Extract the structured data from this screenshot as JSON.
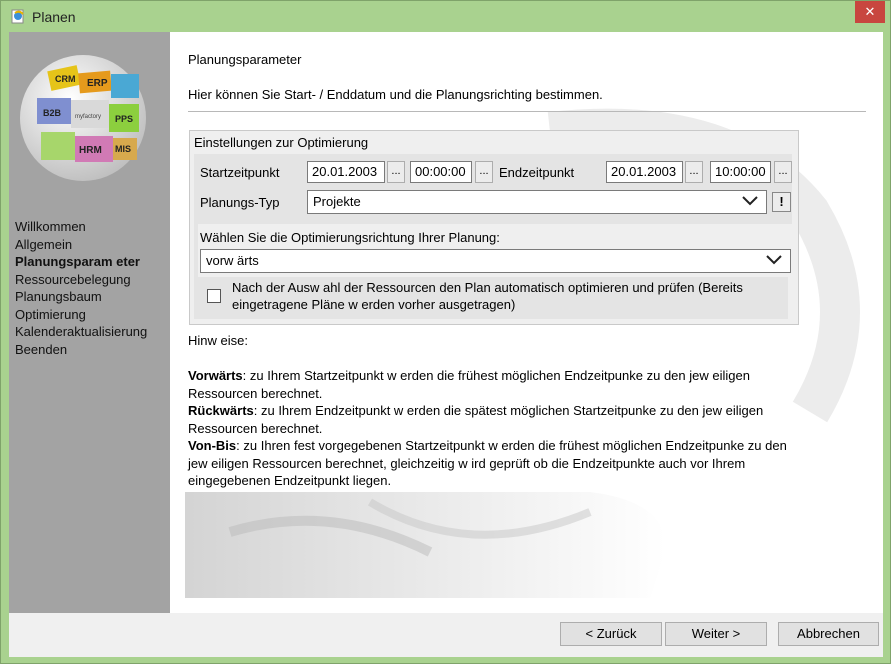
{
  "window": {
    "title": "Planen",
    "close_label": "✕"
  },
  "sidebar": {
    "items": [
      {
        "label": "Willkommen",
        "active": false
      },
      {
        "label": "Allgemein",
        "active": false
      },
      {
        "label": "Planungsparam eter",
        "active": true
      },
      {
        "label": "Ressourcebelegung",
        "active": false
      },
      {
        "label": "Planungsbaum",
        "active": false
      },
      {
        "label": "Optimierung",
        "active": false
      },
      {
        "label": "Kalenderaktualisierung",
        "active": false
      },
      {
        "label": "Beenden",
        "active": false
      }
    ],
    "logo_labels": [
      "CRM",
      "ERP",
      "B2B",
      "myfactory",
      "PPS",
      "HRM",
      "MIS"
    ]
  },
  "page": {
    "title": "Planungsparameter",
    "description": "Hier können Sie Start- / Enddatum und die Planungsrichting bestimmen."
  },
  "settings": {
    "group_title": "Einstellungen zur Optimierung",
    "start_label": "Startzeitpunkt",
    "start_date": "20.01.2003",
    "start_time": "00:00:00",
    "end_label": "Endzeitpunkt",
    "end_date": "20.01.2003",
    "end_time": "10:00:00",
    "ellipsis": "...",
    "plan_type_label": "Planungs-Typ",
    "plan_type_value": "Projekte",
    "plan_type_info": "!",
    "direction_prompt": "Wählen Sie die Optimierungsrichtung Ihrer Planung:",
    "direction_value": "vorw ärts",
    "auto_optimize_label": "Nach der Ausw ahl der Ressourcen den Plan automatisch optimieren und prüfen (Bereits eingetragene Pläne w erden vorher ausgetragen)",
    "auto_optimize_checked": false
  },
  "hints": {
    "heading": "Hinw eise:",
    "forward_term": "Vorwärts",
    "forward_text": ": zu Ihrem Startzeitpunkt w erden die frühest möglichen Endzeitpunke zu den jew eiligen Ressourcen berechnet.",
    "backward_term": "Rückwärts",
    "backward_text": ": zu Ihrem Endzeitpunkt w erden die spätest möglichen Startzeitpunke zu den jew eiligen Ressourcen berechnet.",
    "frombis_term": "Von-Bis",
    "frombis_text": ": zu Ihren fest vorgegebenen Startzeitpunkt w erden die frühest möglichen Endzeitpunke zu den jew eiligen Ressourcen berechnet, gleichzeitig w ird geprüft ob die Endzeitpunkte auch vor Ihrem eingegebenen Endzeitpunkt liegen."
  },
  "footer": {
    "back": "< Zurück",
    "next": "Weiter >",
    "cancel": "Abbrechen"
  },
  "colors": {
    "frame": "#a9d28f",
    "sidebar": "#a3a3a3",
    "close": "#c8463f"
  }
}
